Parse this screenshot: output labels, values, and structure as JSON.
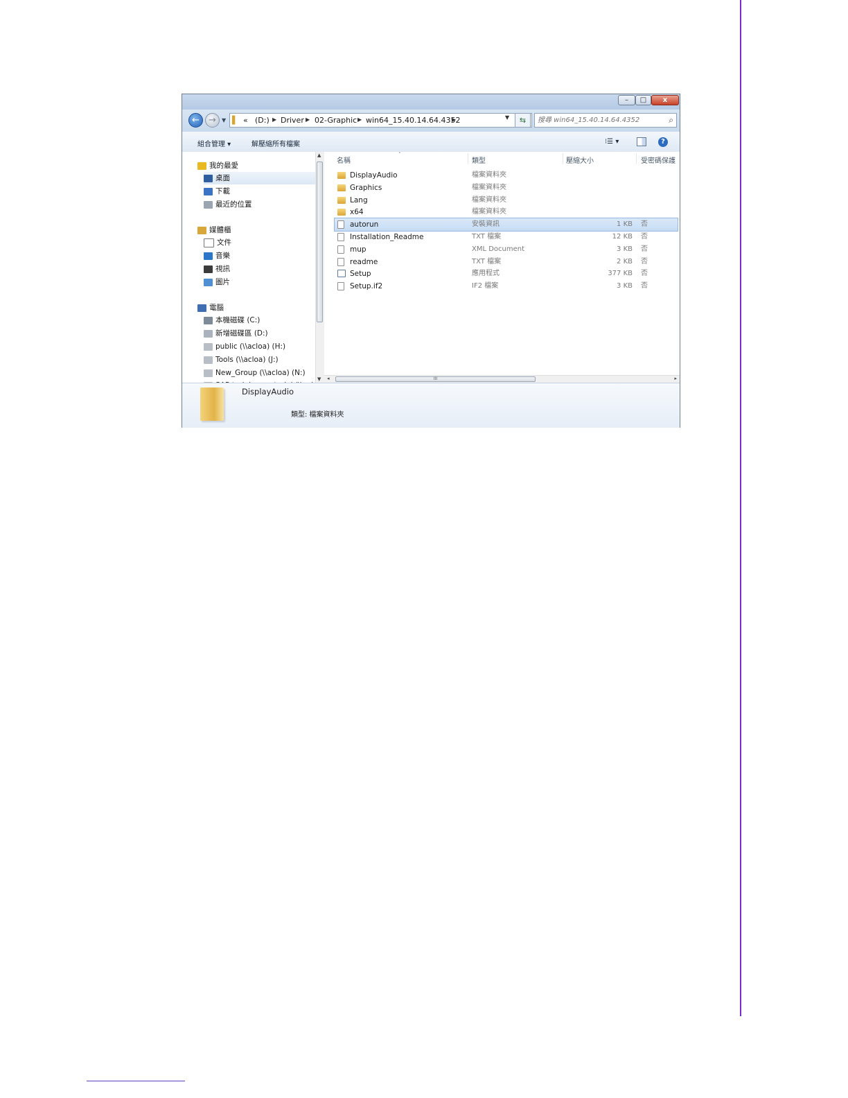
{
  "window": {
    "controls": {
      "minimize": "–",
      "maximize": "□",
      "close": "x"
    }
  },
  "navigation": {
    "back_icon": "←",
    "forward_icon": "→",
    "breadcrumb": [
      "«",
      "(D:)",
      "Driver",
      "02-Graphic",
      "win64_15.40.14.64.4352"
    ],
    "search_placeholder": "搜尋 win64_15.40.14.64.4352"
  },
  "toolbar": {
    "organize": "組合管理 ▾",
    "extract_all": "解壓縮所有檔案",
    "views": "⁝☰ ▾",
    "help": "?"
  },
  "sidebar": {
    "items": [
      {
        "label": "我的最愛",
        "icon": "star-icon",
        "level": 0
      },
      {
        "label": "桌面",
        "icon": "desktop-icon",
        "level": 1,
        "selected": true
      },
      {
        "label": "下載",
        "icon": "downloads-icon",
        "level": 1
      },
      {
        "label": "最近的位置",
        "icon": "recent-places-icon",
        "level": 1
      },
      {
        "label": "媒體櫃",
        "icon": "libraries-icon",
        "level": 0
      },
      {
        "label": "文件",
        "icon": "documents-icon",
        "level": 1
      },
      {
        "label": "音樂",
        "icon": "music-icon",
        "level": 1
      },
      {
        "label": "視訊",
        "icon": "video-icon",
        "level": 1
      },
      {
        "label": "圖片",
        "icon": "pictures-icon",
        "level": 1
      },
      {
        "label": "電腦",
        "icon": "computer-icon",
        "level": 0
      },
      {
        "label": "本機磁碟 (C:)",
        "icon": "local-disk-icon",
        "level": 1
      },
      {
        "label": "新增磁碟區 (D:)",
        "icon": "drive-icon",
        "level": 1
      },
      {
        "label": "public (\\\\acloa) (H:)",
        "icon": "network-drive-icon",
        "level": 1
      },
      {
        "label": "Tools (\\\\acloa) (J:)",
        "icon": "network-drive-icon",
        "level": 1
      },
      {
        "label": "New_Group (\\\\acloa) (N:)",
        "icon": "network-drive-icon",
        "level": 1
      },
      {
        "label": "SAP training material (\\\\acloa",
        "icon": "network-drive-icon",
        "level": 1
      }
    ]
  },
  "file_list": {
    "columns": [
      "名稱",
      "類型",
      "壓縮大小",
      "受密碼保護"
    ],
    "sort_indicator": "˄",
    "rows": [
      {
        "name": "DisplayAudio",
        "type": "檔案資料夾",
        "size": "",
        "protected": "",
        "icon": "folder-icon"
      },
      {
        "name": "Graphics",
        "type": "檔案資料夾",
        "size": "",
        "protected": "",
        "icon": "folder-icon"
      },
      {
        "name": "Lang",
        "type": "檔案資料夾",
        "size": "",
        "protected": "",
        "icon": "folder-icon"
      },
      {
        "name": "x64",
        "type": "檔案資料夾",
        "size": "",
        "protected": "",
        "icon": "folder-icon"
      },
      {
        "name": "autorun",
        "type": "安裝資訊",
        "size": "1 KB",
        "protected": "否",
        "icon": "setup-info-icon",
        "selected": true
      },
      {
        "name": "Installation_Readme",
        "type": "TXT 檔案",
        "size": "12 KB",
        "protected": "否",
        "icon": "text-file-icon"
      },
      {
        "name": "mup",
        "type": "XML Document",
        "size": "3 KB",
        "protected": "否",
        "icon": "xml-file-icon"
      },
      {
        "name": "readme",
        "type": "TXT 檔案",
        "size": "2 KB",
        "protected": "否",
        "icon": "text-file-icon"
      },
      {
        "name": "Setup",
        "type": "應用程式",
        "size": "377 KB",
        "protected": "否",
        "icon": "application-icon"
      },
      {
        "name": "Setup.if2",
        "type": "IF2 檔案",
        "size": "3 KB",
        "protected": "否",
        "icon": "file-icon"
      }
    ]
  },
  "details_pane": {
    "name": "DisplayAudio",
    "type_line": "類型: 檔案資料夾"
  },
  "scrollbar": {
    "grip": "III"
  },
  "colors": {
    "page_rule": "#7b2ccf",
    "selection": "#c6dcf5"
  }
}
